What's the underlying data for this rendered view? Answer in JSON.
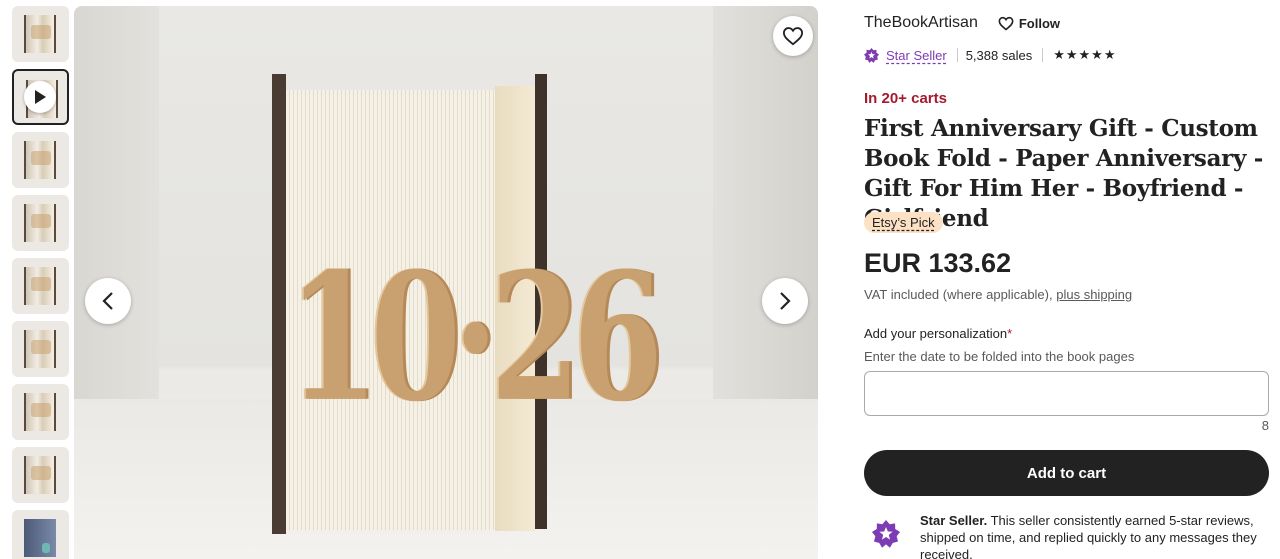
{
  "gallery": {
    "thumbnails": [
      {
        "label": "thumbnail 1"
      },
      {
        "label": "video thumbnail"
      },
      {
        "label": "thumbnail 3"
      },
      {
        "label": "thumbnail 4"
      },
      {
        "label": "thumbnail 5"
      },
      {
        "label": "thumbnail 6"
      },
      {
        "label": "thumbnail 7"
      },
      {
        "label": "thumbnail 8"
      },
      {
        "label": "thumbnail 9"
      }
    ],
    "selected_index": 1,
    "main_image_text": "10·26"
  },
  "shop": {
    "name": "TheBookArtisan",
    "follow_label": "Follow",
    "star_seller_label": "Star Seller",
    "sales": "5,388 sales",
    "rating": 5
  },
  "listing": {
    "in_carts": "In 20+ carts",
    "title": "First Anniversary Gift - Custom Book Fold - Paper Anniversary - Gift For Him Her - Boyfriend - Girlfriend",
    "badge": "Etsy’s Pick",
    "price": "EUR 133.62",
    "vat_text": "VAT included (where applicable),",
    "shipping_link": "plus shipping"
  },
  "personalization": {
    "label": "Add your personalization",
    "required_mark": "*",
    "hint": "Enter the date to be folded into the book pages",
    "value": "",
    "counter": "8"
  },
  "actions": {
    "add_to_cart": "Add to cart"
  },
  "star_info": {
    "bold": "Star Seller.",
    "text": " This seller consistently earned 5-star reviews, shipped on time, and replied quickly to any messages they received."
  },
  "colors": {
    "accent_purple": "#7d3cb4",
    "carts_red": "#a61a2e",
    "badge_bg": "#fde1c5",
    "button_dark": "#222222"
  },
  "icons": {
    "play": "play-icon",
    "heart": "heart-icon",
    "prev": "chevron-left-icon",
    "next": "chevron-right-icon",
    "star_seller": "star-seller-badge-icon",
    "rating_star": "star-icon"
  }
}
